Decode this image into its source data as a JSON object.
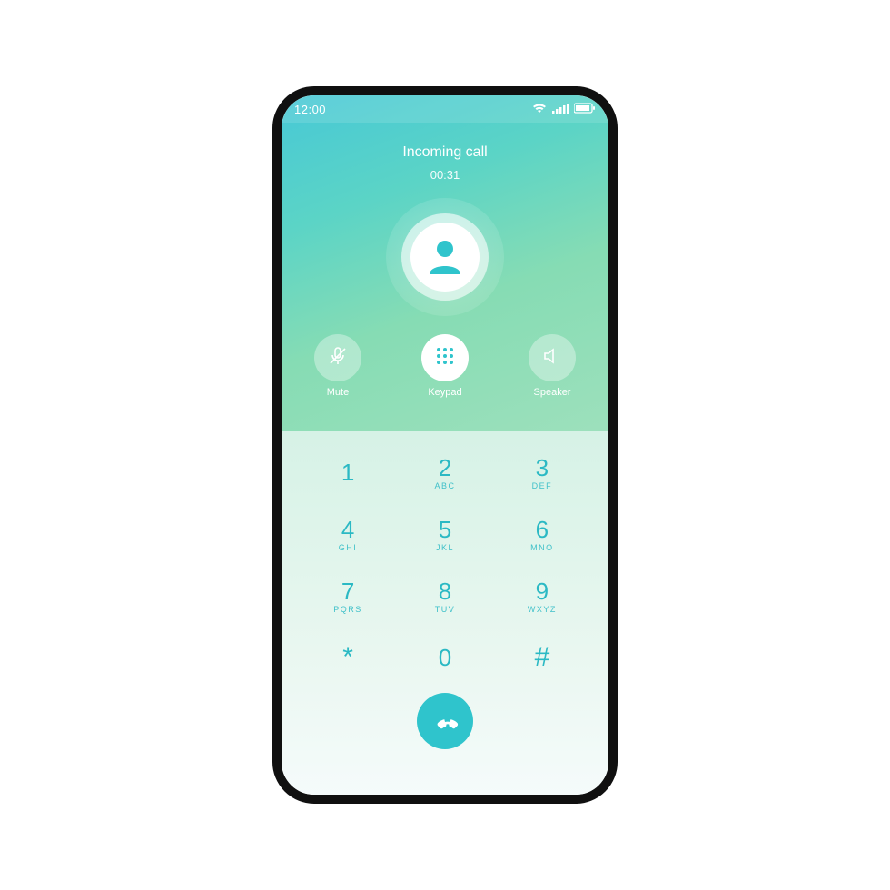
{
  "status": {
    "time": "12:00"
  },
  "call": {
    "title": "Incoming call",
    "timer": "00:31"
  },
  "controls": {
    "mute": {
      "label": "Mute"
    },
    "keypad": {
      "label": "Keypad"
    },
    "speaker": {
      "label": "Speaker"
    }
  },
  "keypad": [
    {
      "digit": "1",
      "letters": ""
    },
    {
      "digit": "2",
      "letters": "ABC"
    },
    {
      "digit": "3",
      "letters": "DEF"
    },
    {
      "digit": "4",
      "letters": "GHI"
    },
    {
      "digit": "5",
      "letters": "JKL"
    },
    {
      "digit": "6",
      "letters": "MNO"
    },
    {
      "digit": "7",
      "letters": "PQRS"
    },
    {
      "digit": "8",
      "letters": "TUV"
    },
    {
      "digit": "9",
      "letters": "WXYZ"
    },
    {
      "digit": "*",
      "letters": ""
    },
    {
      "digit": "0",
      "letters": ""
    },
    {
      "digit": "#",
      "letters": ""
    }
  ],
  "colors": {
    "accent": "#2fc4cc",
    "keypadText": "#2bb9c4"
  }
}
